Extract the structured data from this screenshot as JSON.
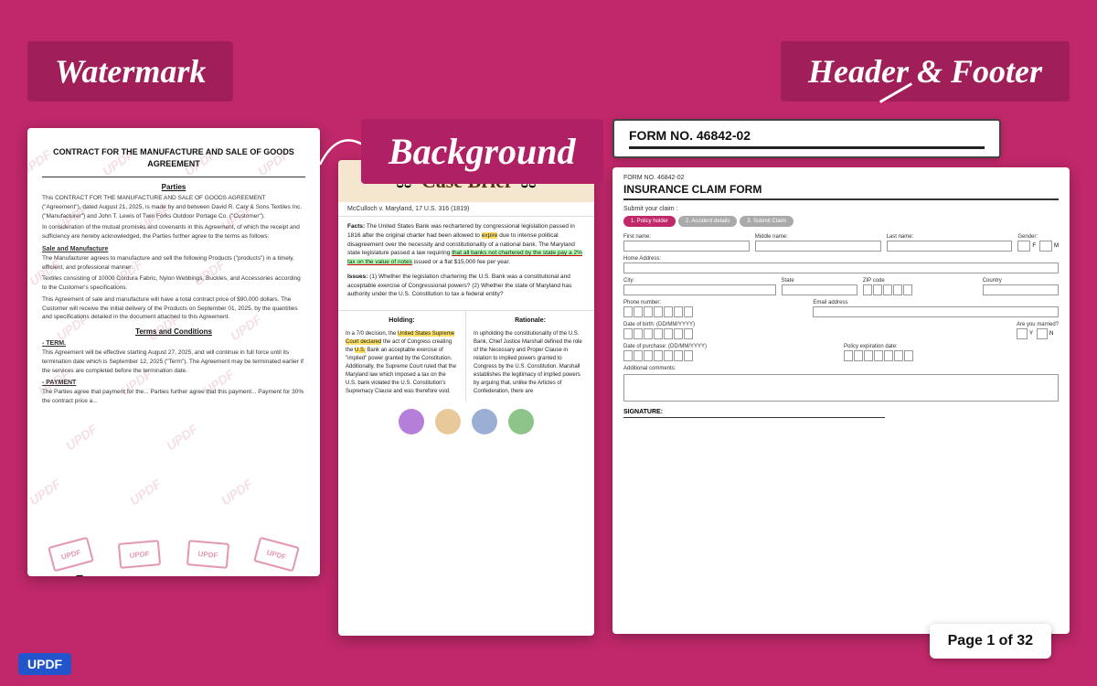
{
  "page": {
    "background_color": "#c0286a"
  },
  "banners": {
    "watermark": "Watermark",
    "header_footer": "Header & Footer",
    "background": "Background"
  },
  "contract": {
    "title": "CONTRACT FOR THE MANUFACTURE AND SALE OF GOODS AGREEMENT",
    "parties_heading": "Parties",
    "parties_text": "This CONTRACT FOR THE MANUFACTURE AND SALE OF GOODS AGREEMENT (\"Agreement\"), dated August 21, 2025, is made by and between David R. Cary & Sons Textiles Inc. (\"Manufacturer\") and John T. Lewis of Twin Forks Outdoor Portage Co. (\"Customer\").",
    "consideration_text": "In consideration of the mutual promises and covenants in this Agreement, of which the receipt and sufficiency are hereby acknowledged, the Parties further agree to the terms as follows:",
    "sale_heading": "Sale and Manufacture",
    "sale_text": "The Manufacturer agrees to manufacture and sell the following Products (\"products\") in a timely, efficient, and professional manner.",
    "textiles_text": "Textiles consisting of 10000 Cordura Fabric, Nylon Webbings, Buckles, and Accessories according to the Customer's specifications.",
    "payment_text": "This Agreement of sale and manufacture will have a total contract price of $90,000 dollars. The Customer will receive the initial delivery of the Products on September 01, 2025. by the quantities and specifications detailed in the document attached to this Agreement.",
    "terms_heading": "Terms and Conditions",
    "terms_text": "This Agreement will be effective starting August 27, 2025, and will continue in full force until its termination date which is September 12, 2025 (\"Term\"). The Agreement may be terminated earlier if the services are completed before the termination date.",
    "payment_heading": "PAYMENT",
    "payment_text2": "The Parties agree that payment for the... Parties further agree that this payment... Payment for 30% the contract price a...",
    "watermark_text": "UPDF"
  },
  "brief": {
    "title": "Case Brief",
    "case_name": "McCulloch v. Maryland, 17 U.S. 316 (1819)",
    "facts_label": "Facts:",
    "facts_text": "The United States Bank was rechartered by congressional legislation passed in 1816 after the original charter had been allowed to expire due to intense political disagreement over the necessity and constitutionality of a national bank. The Maryland state legislature passed a law requiring that all banks not chartered by the state pay a 2% tax on the value of notes issued or a flat $15,000 fee per year.",
    "issues_label": "Issues:",
    "issues_text": "(1) Whether the legislation chartering the U.S. Bank was a constitutional and acceptable exercise of Congressional powers? (2) Whether the state of Maryland has authority under the U.S. Constitution to tax a federal entity?",
    "holding_label": "Holding:",
    "holding_text": "In a 7/0 decision, the United States Supreme Court declared the act of Congress creating the U.S. Bank an acceptable exercise of \"implied\" power granted by the Constitution. Additionally, the Supreme Court ruled that the Maryland law which imposed a tax on the U.S. bank violated the U.S. Constitution's Supremacy Clause and was therefore void.",
    "rationale_label": "Rationale:",
    "rationale_text": "In upholding the constitutionality of the U.S. Bank, Chief Justice Marshall defined the role of the Necessary and Proper Clause in relation to implied powers granted to Congress by the U.S. Constitution. Marshall establishes the legitimacy of implied powers by arguing that, unlike the Articles of Confederation, there are",
    "swatches": [
      "#b57ed9",
      "#e8c99a",
      "#9baed4",
      "#8dc48a"
    ]
  },
  "form_banner": {
    "form_no": "FORM NO. 46842-02"
  },
  "form": {
    "form_no": "FORM NO. 46842-02",
    "title": "INSURANCE CLAIM FORM",
    "submit_label": "Submit your claim :",
    "steps": [
      {
        "label": "1. Policy holder",
        "active": true
      },
      {
        "label": "2. Accident details",
        "active": false
      },
      {
        "label": "3. Submit Claim",
        "active": false
      }
    ],
    "first_name_label": "First name:",
    "middle_name_label": "Middle name:",
    "last_name_label": "Last name:",
    "gender_label": "Gender:",
    "gender_options": [
      "F",
      "M"
    ],
    "home_address_label": "Home Address:",
    "city_label": "City:",
    "state_label": "State",
    "zip_label": "ZIP code",
    "country_label": "Country",
    "phone_label": "Phone number:",
    "email_label": "Email address",
    "dob_label": "Date of birth: (DD/MM/YYYY)",
    "married_label": "Are you married?",
    "married_options": [
      "Y",
      "N"
    ],
    "purchase_date_label": "Date of purchase: (DD/MM/YYYY)",
    "policy_exp_label": "Policy expiration date:",
    "comments_label": "Additional comments:",
    "signature_label": "SIGNATURE:"
  },
  "page_counter": {
    "text": "Page 1 of 32"
  },
  "updf_logo": "UPDF"
}
